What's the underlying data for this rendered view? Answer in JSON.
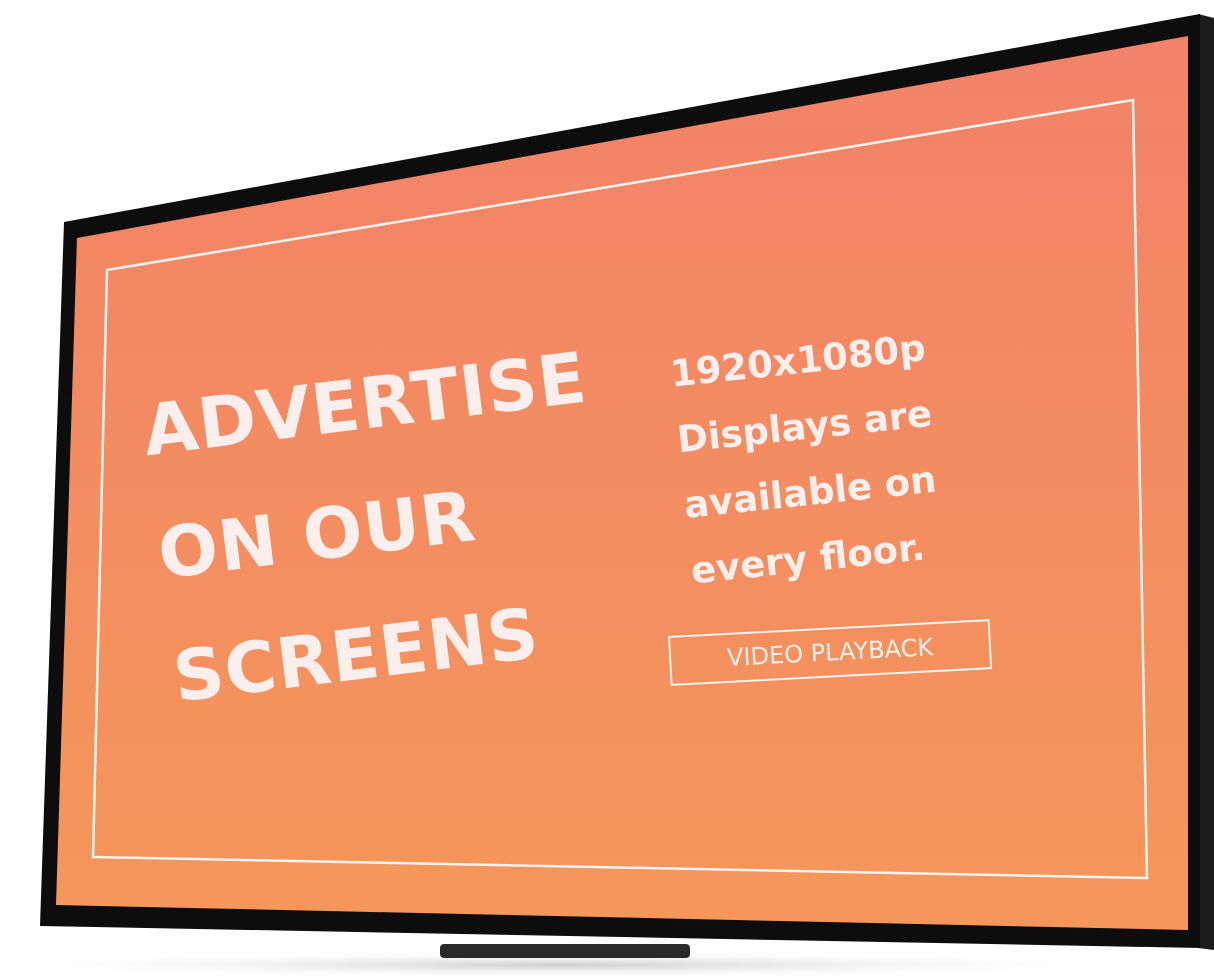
{
  "colors": {
    "screen_top": "#f28268",
    "screen_bottom": "#f5975a",
    "bezel": "#0d0d0d",
    "text": "#fbefee",
    "frame_line": "#fdf3ef"
  },
  "headline": {
    "line1": "ADVERTISE",
    "line2": "ON OUR",
    "line3": "SCREENS"
  },
  "details": {
    "line1": "1920x1080p",
    "line2": "Displays are",
    "line3": "available on",
    "line4": "every floor."
  },
  "cta": {
    "label": "VIDEO PLAYBACK"
  }
}
